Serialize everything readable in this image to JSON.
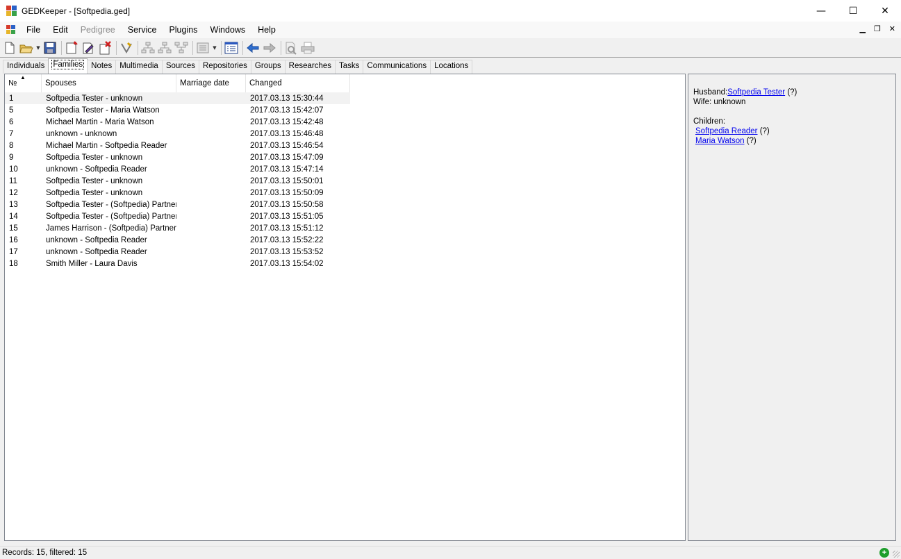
{
  "window": {
    "title": "GEDKeeper - [Softpedia.ged]",
    "minimize": "—",
    "maximize": "☐",
    "close": "✕"
  },
  "menu": {
    "items": [
      "File",
      "Edit",
      "Pedigree",
      "Service",
      "Plugins",
      "Windows",
      "Help"
    ],
    "disabled": [
      "Pedigree"
    ],
    "mdi": {
      "minimize": "▁",
      "restore": "❐",
      "close": "✕"
    }
  },
  "toolbar": {
    "icons": [
      "new-file-icon",
      "open-file-icon",
      "save-icon",
      "add-record-icon",
      "edit-record-icon",
      "delete-record-icon",
      "filter-icon",
      "pedigree-icon",
      "pedigree-d-icon",
      "pedigree-dd-icon",
      "reports-icon",
      "tree-view-icon",
      "back-icon",
      "forward-icon",
      "print-preview-icon",
      "print-icon"
    ]
  },
  "tabs": [
    "Individuals",
    "Families",
    "Notes",
    "Multimedia",
    "Sources",
    "Repositories",
    "Groups",
    "Researches",
    "Tasks",
    "Communications",
    "Locations"
  ],
  "active_tab": "Families",
  "list": {
    "columns": [
      "№",
      "Spouses",
      "Marriage date",
      "Changed"
    ],
    "sort_indicator": "▲",
    "rows": [
      {
        "num": "1",
        "spouses": "Softpedia Tester - unknown",
        "marriage": "",
        "changed": "2017.03.13 15:30:44"
      },
      {
        "num": "5",
        "spouses": "Softpedia Tester - Maria Watson",
        "marriage": "",
        "changed": "2017.03.13 15:42:07"
      },
      {
        "num": "6",
        "spouses": "Michael Martin - Maria Watson",
        "marriage": "",
        "changed": "2017.03.13 15:42:48"
      },
      {
        "num": "7",
        "spouses": "unknown - unknown",
        "marriage": "",
        "changed": "2017.03.13 15:46:48"
      },
      {
        "num": "8",
        "spouses": "Michael Martin - Softpedia Reader",
        "marriage": "",
        "changed": "2017.03.13 15:46:54"
      },
      {
        "num": "9",
        "spouses": "Softpedia Tester - unknown",
        "marriage": "",
        "changed": "2017.03.13 15:47:09"
      },
      {
        "num": "10",
        "spouses": "unknown - Softpedia Reader",
        "marriage": "",
        "changed": "2017.03.13 15:47:14"
      },
      {
        "num": "11",
        "spouses": "Softpedia Tester - unknown",
        "marriage": "",
        "changed": "2017.03.13 15:50:01"
      },
      {
        "num": "12",
        "spouses": "Softpedia Tester - unknown",
        "marriage": "",
        "changed": "2017.03.13 15:50:09"
      },
      {
        "num": "13",
        "spouses": "Softpedia Tester - (Softpedia) Partner",
        "marriage": "",
        "changed": "2017.03.13 15:50:58"
      },
      {
        "num": "14",
        "spouses": "Softpedia Tester - (Softpedia) Partner",
        "marriage": "",
        "changed": "2017.03.13 15:51:05"
      },
      {
        "num": "15",
        "spouses": "James Harrison - (Softpedia) Partner",
        "marriage": "",
        "changed": "2017.03.13 15:51:12"
      },
      {
        "num": "16",
        "spouses": "unknown - Softpedia Reader",
        "marriage": "",
        "changed": "2017.03.13 15:52:22"
      },
      {
        "num": "17",
        "spouses": "unknown - Softpedia Reader",
        "marriage": "",
        "changed": "2017.03.13 15:53:52"
      },
      {
        "num": "18",
        "spouses": "Smith Miller - Laura Davis",
        "marriage": "",
        "changed": "2017.03.13 15:54:02"
      }
    ]
  },
  "info": {
    "husband_label": "Husband:",
    "husband_name": "Softpedia Tester",
    "husband_suffix": " (?)",
    "wife_label": "Wife: unknown",
    "children_label": "Children:",
    "children": [
      {
        "name": "Softpedia Reader",
        "suffix": " (?)"
      },
      {
        "name": "Maria Watson",
        "suffix": " (?)"
      }
    ]
  },
  "status": {
    "text": "Records: 15, filtered: 15",
    "icon": "plus-icon",
    "icon_glyph": "+"
  },
  "colors": {
    "titlebar_bg": "#ffffff",
    "window_bg": "#f0f0f0",
    "list_bg": "#ffffff",
    "link": "#0000ee",
    "status_ok": "#1e9e2c"
  }
}
